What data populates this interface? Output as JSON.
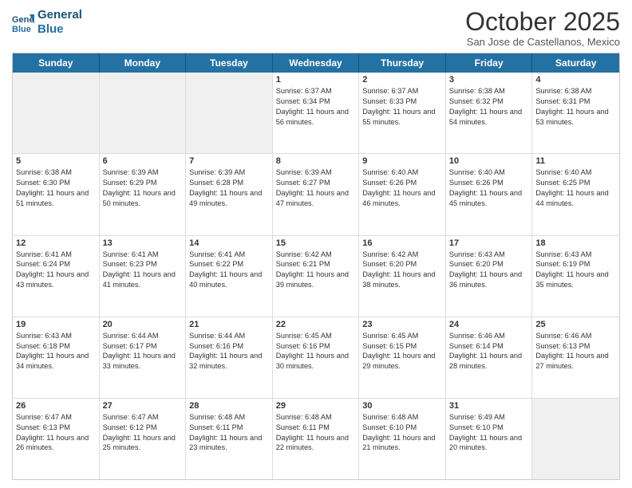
{
  "header": {
    "logo_line1": "General",
    "logo_line2": "Blue",
    "month": "October 2025",
    "location": "San Jose de Castellanos, Mexico"
  },
  "days_of_week": [
    "Sunday",
    "Monday",
    "Tuesday",
    "Wednesday",
    "Thursday",
    "Friday",
    "Saturday"
  ],
  "weeks": [
    [
      {
        "day": "",
        "text": "",
        "shaded": true
      },
      {
        "day": "",
        "text": "",
        "shaded": true
      },
      {
        "day": "",
        "text": "",
        "shaded": true
      },
      {
        "day": "1",
        "text": "Sunrise: 6:37 AM\nSunset: 6:34 PM\nDaylight: 11 hours and 56 minutes."
      },
      {
        "day": "2",
        "text": "Sunrise: 6:37 AM\nSunset: 6:33 PM\nDaylight: 11 hours and 55 minutes."
      },
      {
        "day": "3",
        "text": "Sunrise: 6:38 AM\nSunset: 6:32 PM\nDaylight: 11 hours and 54 minutes."
      },
      {
        "day": "4",
        "text": "Sunrise: 6:38 AM\nSunset: 6:31 PM\nDaylight: 11 hours and 53 minutes."
      }
    ],
    [
      {
        "day": "5",
        "text": "Sunrise: 6:38 AM\nSunset: 6:30 PM\nDaylight: 11 hours and 51 minutes."
      },
      {
        "day": "6",
        "text": "Sunrise: 6:39 AM\nSunset: 6:29 PM\nDaylight: 11 hours and 50 minutes."
      },
      {
        "day": "7",
        "text": "Sunrise: 6:39 AM\nSunset: 6:28 PM\nDaylight: 11 hours and 49 minutes."
      },
      {
        "day": "8",
        "text": "Sunrise: 6:39 AM\nSunset: 6:27 PM\nDaylight: 11 hours and 47 minutes."
      },
      {
        "day": "9",
        "text": "Sunrise: 6:40 AM\nSunset: 6:26 PM\nDaylight: 11 hours and 46 minutes."
      },
      {
        "day": "10",
        "text": "Sunrise: 6:40 AM\nSunset: 6:26 PM\nDaylight: 11 hours and 45 minutes."
      },
      {
        "day": "11",
        "text": "Sunrise: 6:40 AM\nSunset: 6:25 PM\nDaylight: 11 hours and 44 minutes."
      }
    ],
    [
      {
        "day": "12",
        "text": "Sunrise: 6:41 AM\nSunset: 6:24 PM\nDaylight: 11 hours and 43 minutes."
      },
      {
        "day": "13",
        "text": "Sunrise: 6:41 AM\nSunset: 6:23 PM\nDaylight: 11 hours and 41 minutes."
      },
      {
        "day": "14",
        "text": "Sunrise: 6:41 AM\nSunset: 6:22 PM\nDaylight: 11 hours and 40 minutes."
      },
      {
        "day": "15",
        "text": "Sunrise: 6:42 AM\nSunset: 6:21 PM\nDaylight: 11 hours and 39 minutes."
      },
      {
        "day": "16",
        "text": "Sunrise: 6:42 AM\nSunset: 6:20 PM\nDaylight: 11 hours and 38 minutes."
      },
      {
        "day": "17",
        "text": "Sunrise: 6:43 AM\nSunset: 6:20 PM\nDaylight: 11 hours and 36 minutes."
      },
      {
        "day": "18",
        "text": "Sunrise: 6:43 AM\nSunset: 6:19 PM\nDaylight: 11 hours and 35 minutes."
      }
    ],
    [
      {
        "day": "19",
        "text": "Sunrise: 6:43 AM\nSunset: 6:18 PM\nDaylight: 11 hours and 34 minutes."
      },
      {
        "day": "20",
        "text": "Sunrise: 6:44 AM\nSunset: 6:17 PM\nDaylight: 11 hours and 33 minutes."
      },
      {
        "day": "21",
        "text": "Sunrise: 6:44 AM\nSunset: 6:16 PM\nDaylight: 11 hours and 32 minutes."
      },
      {
        "day": "22",
        "text": "Sunrise: 6:45 AM\nSunset: 6:16 PM\nDaylight: 11 hours and 30 minutes."
      },
      {
        "day": "23",
        "text": "Sunrise: 6:45 AM\nSunset: 6:15 PM\nDaylight: 11 hours and 29 minutes."
      },
      {
        "day": "24",
        "text": "Sunrise: 6:46 AM\nSunset: 6:14 PM\nDaylight: 11 hours and 28 minutes."
      },
      {
        "day": "25",
        "text": "Sunrise: 6:46 AM\nSunset: 6:13 PM\nDaylight: 11 hours and 27 minutes."
      }
    ],
    [
      {
        "day": "26",
        "text": "Sunrise: 6:47 AM\nSunset: 6:13 PM\nDaylight: 11 hours and 26 minutes."
      },
      {
        "day": "27",
        "text": "Sunrise: 6:47 AM\nSunset: 6:12 PM\nDaylight: 11 hours and 25 minutes."
      },
      {
        "day": "28",
        "text": "Sunrise: 6:48 AM\nSunset: 6:11 PM\nDaylight: 11 hours and 23 minutes."
      },
      {
        "day": "29",
        "text": "Sunrise: 6:48 AM\nSunset: 6:11 PM\nDaylight: 11 hours and 22 minutes."
      },
      {
        "day": "30",
        "text": "Sunrise: 6:48 AM\nSunset: 6:10 PM\nDaylight: 11 hours and 21 minutes."
      },
      {
        "day": "31",
        "text": "Sunrise: 6:49 AM\nSunset: 6:10 PM\nDaylight: 11 hours and 20 minutes."
      },
      {
        "day": "",
        "text": "",
        "shaded": true
      }
    ]
  ]
}
